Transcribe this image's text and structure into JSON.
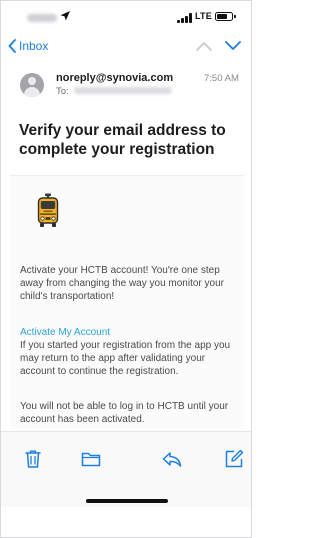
{
  "status_bar": {
    "carrier_label": "LTE",
    "battery_level": 0.75,
    "icons": [
      "location-arrow-icon",
      "signal-bars-icon",
      "battery-icon"
    ]
  },
  "nav": {
    "back_label": "Inbox",
    "icons": [
      "chevron-left-icon",
      "chevron-up-icon",
      "chevron-down-icon"
    ]
  },
  "message": {
    "from": "noreply@synovia.com",
    "to_label": "To:",
    "time": "7:50 AM",
    "subject": "Verify your email address to complete your registration"
  },
  "email_body": {
    "logo_icon": "school-bus-icon",
    "intro": "Activate your HCTB account! You're one step away from changing the way you monitor your child's transportation!",
    "activate_link": "Activate My Account",
    "instructions": "If you started your registration from the app you may return to the app after validating your account to continue the registration.",
    "warning": "You will not be able to log in to HCTB until your account has been activated."
  },
  "toolbar": {
    "icons": [
      "trash-icon",
      "folder-icon",
      "reply-icon",
      "compose-icon"
    ]
  },
  "colors": {
    "ios_blue": "#1c7ee0",
    "link_blue": "#2da4d4",
    "bus_yellow": "#f5b21c"
  }
}
